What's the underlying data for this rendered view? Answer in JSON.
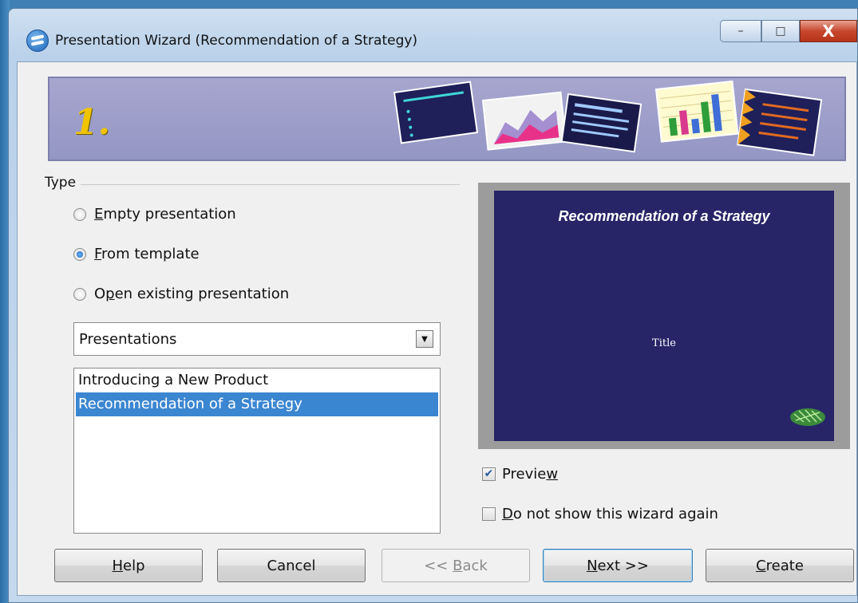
{
  "window": {
    "title": "Presentation Wizard (Recommendation of a Strategy)",
    "controls": {
      "minimize": "–",
      "maximize": "□",
      "close": "X"
    }
  },
  "banner": {
    "step": "1."
  },
  "type_group": {
    "label": "Type",
    "options": [
      {
        "mnemonic": "E",
        "rest": "mpty presentation",
        "selected": false
      },
      {
        "mnemonic": "F",
        "rest": "rom template",
        "selected": true
      },
      {
        "prefix": "O",
        "mnemonic": "p",
        "rest": "en existing presentation",
        "selected": false
      }
    ]
  },
  "category_select": {
    "value": "Presentations",
    "arrow": "▼"
  },
  "template_list": {
    "items": [
      "Introducing a New Product",
      "Recommendation of a Strategy"
    ],
    "selected_index": 1
  },
  "preview": {
    "slide_title": "Recommendation of a Strategy",
    "slide_subtitle": "Title",
    "colors": {
      "background": "#272568",
      "frame": "#9c9c9c"
    }
  },
  "checkboxes": {
    "preview": {
      "prefix": "Previe",
      "mnemonic": "w",
      "checked": true,
      "check_mark": "✔"
    },
    "dont_show": {
      "mnemonic": "D",
      "rest": "o not show this wizard again",
      "checked": false
    }
  },
  "buttons": {
    "help": {
      "mnemonic": "H",
      "rest": "elp"
    },
    "cancel": {
      "label": "Cancel"
    },
    "back": {
      "prefix": "<< ",
      "mnemonic": "B",
      "rest": "ack",
      "enabled": false
    },
    "next": {
      "mnemonic": "N",
      "rest": "ext >>"
    },
    "create": {
      "mnemonic": "C",
      "rest": "reate"
    }
  },
  "colors": {
    "selection": "#3b86d1",
    "banner": "#9e9fcb",
    "step_number": "#f0c400"
  }
}
